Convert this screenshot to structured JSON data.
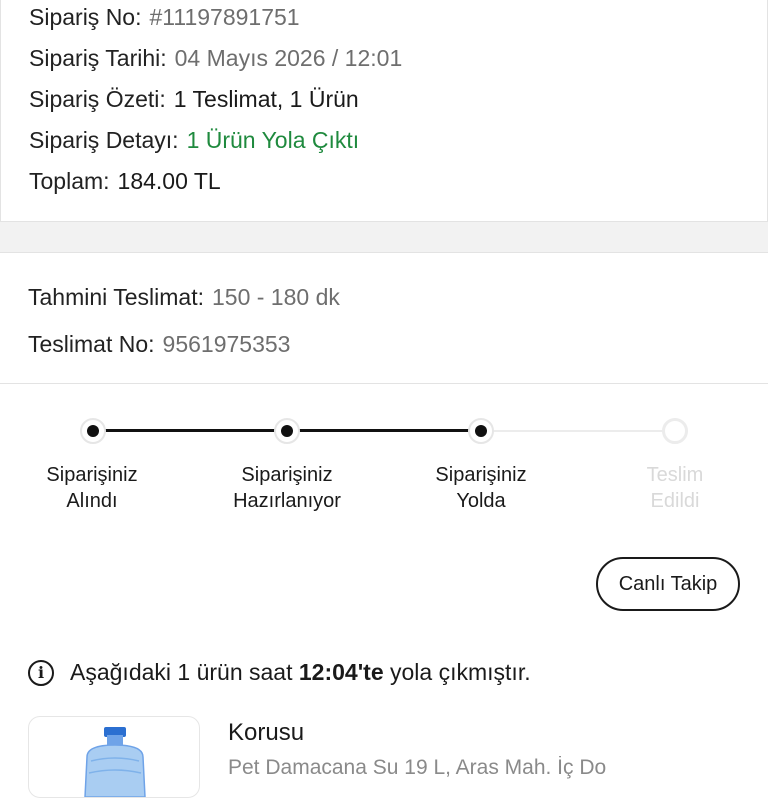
{
  "order": {
    "no_label": "Sipariş No:",
    "no_value": "#11197891751",
    "date_label": "Sipariş Tarihi:",
    "date_value": "04 Mayıs 2026 / 12:01",
    "summary_label": "Sipariş Özeti:",
    "summary_value": "1 Teslimat, 1 Ürün",
    "detail_label": "Sipariş Detayı:",
    "detail_value": "1 Ürün Yola Çıktı",
    "total_label": "Toplam:",
    "total_value": "184.00 TL"
  },
  "delivery": {
    "eta_label": "Tahmini Teslimat:",
    "eta_value": "150 - 180 dk",
    "no_label": "Teslimat No:",
    "no_value": "9561975353"
  },
  "tracker": {
    "steps": [
      {
        "line1": "Siparişiniz",
        "line2": "Alındı",
        "status": "done"
      },
      {
        "line1": "Siparişiniz",
        "line2": "Hazırlanıyor",
        "status": "done"
      },
      {
        "line1": "Siparişiniz",
        "line2": "Yolda",
        "status": "done"
      },
      {
        "line1": "Teslim",
        "line2": "Edildi",
        "status": "pending"
      }
    ],
    "live_button": "Canlı Takip"
  },
  "info": {
    "icon": "info-icon",
    "text_before": "Aşağıdaki 1 ürün saat ",
    "time": "12:04'te",
    "text_after": " yola çıkmıştır."
  },
  "product": {
    "title": "Korusu",
    "address": "Pet Damacana Su 19 L, Aras Mah. İç Do"
  },
  "colors": {
    "accent_green": "#1f8a3e",
    "text_dark": "#1a1a1a",
    "text_muted": "#6e6e6e",
    "pending_gray": "#d9d9d9"
  }
}
